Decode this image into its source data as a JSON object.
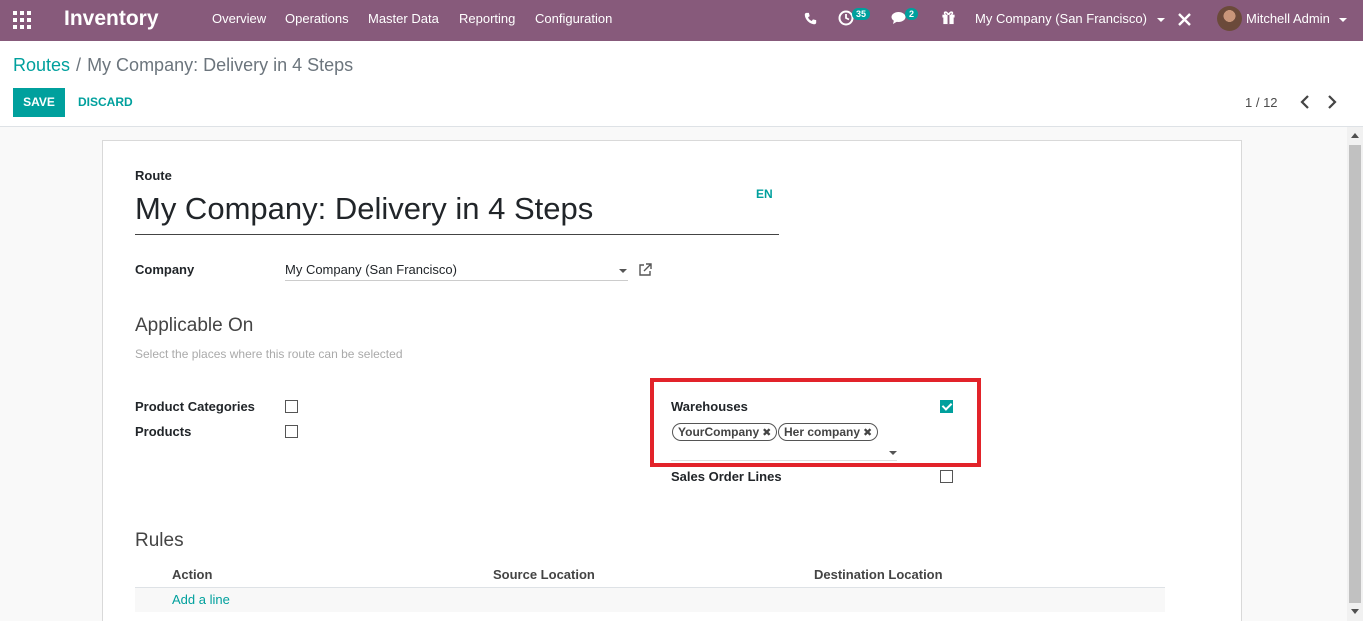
{
  "navbar": {
    "app_name": "Inventory",
    "menu": [
      "Overview",
      "Operations",
      "Master Data",
      "Reporting",
      "Configuration"
    ],
    "activity_count": "35",
    "message_count": "2",
    "company": "My Company (San Francisco)",
    "user": "Mitchell Admin",
    "icons": [
      "apps-grid-icon",
      "phone-icon",
      "clock-icon",
      "chat-icon",
      "gift-icon",
      "close-icon"
    ]
  },
  "breadcrumb": {
    "parent": "Routes",
    "separator": "/",
    "current": "My Company: Delivery in 4 Steps"
  },
  "actions": {
    "save": "SAVE",
    "discard": "DISCARD"
  },
  "pager": {
    "text": "1 / 12"
  },
  "form": {
    "route_label": "Route",
    "route_name": "My Company: Delivery in 4 Steps",
    "lang": "EN",
    "company_label": "Company",
    "company_value": "My Company (San Francisco)",
    "applicable_title": "Applicable On",
    "applicable_help": "Select the places where this route can be selected",
    "product_categories_label": "Product Categories",
    "product_categories_checked": false,
    "products_label": "Products",
    "products_checked": false,
    "warehouses_label": "Warehouses",
    "warehouses_checked": true,
    "warehouse_tags": [
      "YourCompany",
      "Her company"
    ],
    "sale_lines_label": "Sales Order Lines",
    "sale_lines_checked": false,
    "rules_title": "Rules",
    "rules_columns": [
      "Action",
      "Source Location",
      "Destination Location"
    ],
    "add_line": "Add a line"
  },
  "colors": {
    "navbar": "#875a7b",
    "accent": "#00a09d",
    "highlight": "#e2232a"
  }
}
